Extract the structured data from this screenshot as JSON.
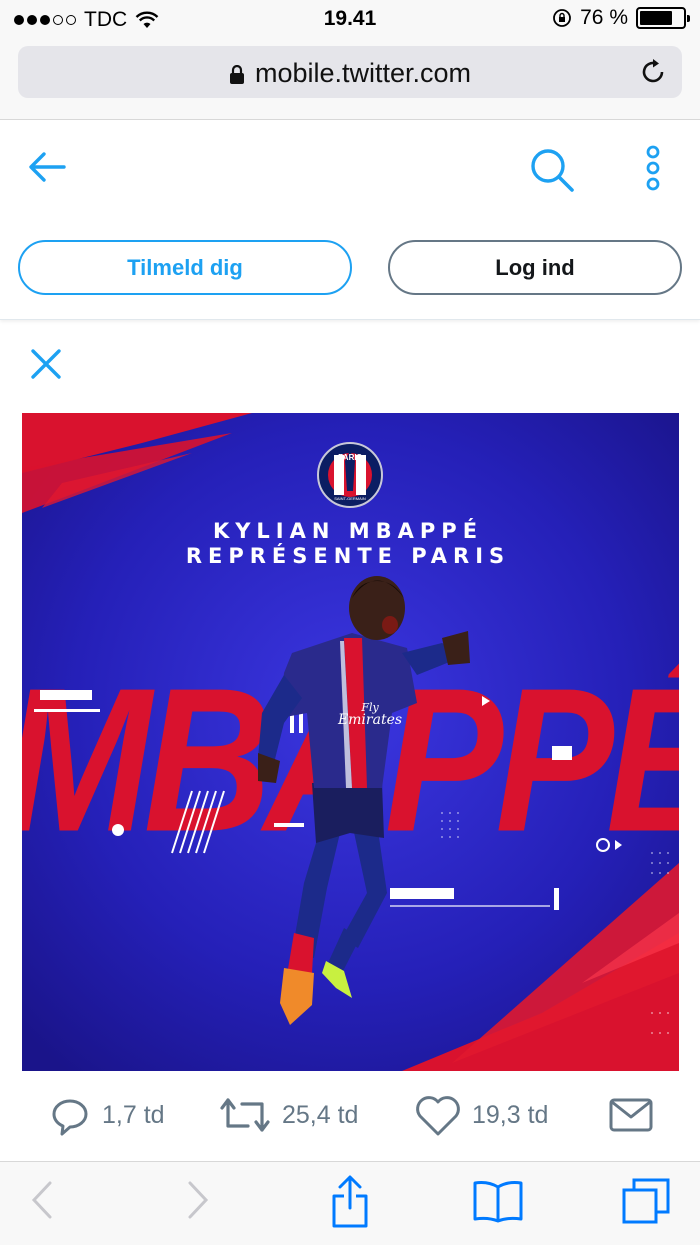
{
  "status": {
    "carrier": "TDC",
    "time": "19.41",
    "battery": "76 %",
    "battery_level": 0.76
  },
  "browser": {
    "url": "mobile.twitter.com"
  },
  "header": {
    "signup_label": "Tilmeld dig",
    "login_label": "Log ind"
  },
  "media": {
    "heading_line1": "KYLIAN MBAPPÉ",
    "heading_line2": "REPRÉSENTE PARIS",
    "big_name": "MBAPPÉ",
    "badge_top": "PARIS",
    "badge_bottom": "SAINT-GERMAIN",
    "shirt_sponsor_1": "Fly",
    "shirt_sponsor_2": "Emirates"
  },
  "actions": {
    "replies": "1,7 td",
    "retweets": "25,4 td",
    "likes": "19,3 td"
  },
  "colors": {
    "twitter_blue": "#1da1f2",
    "ios_blue": "#007aff",
    "psg_navy": "#1c2a8a",
    "psg_red": "#d9122e"
  }
}
